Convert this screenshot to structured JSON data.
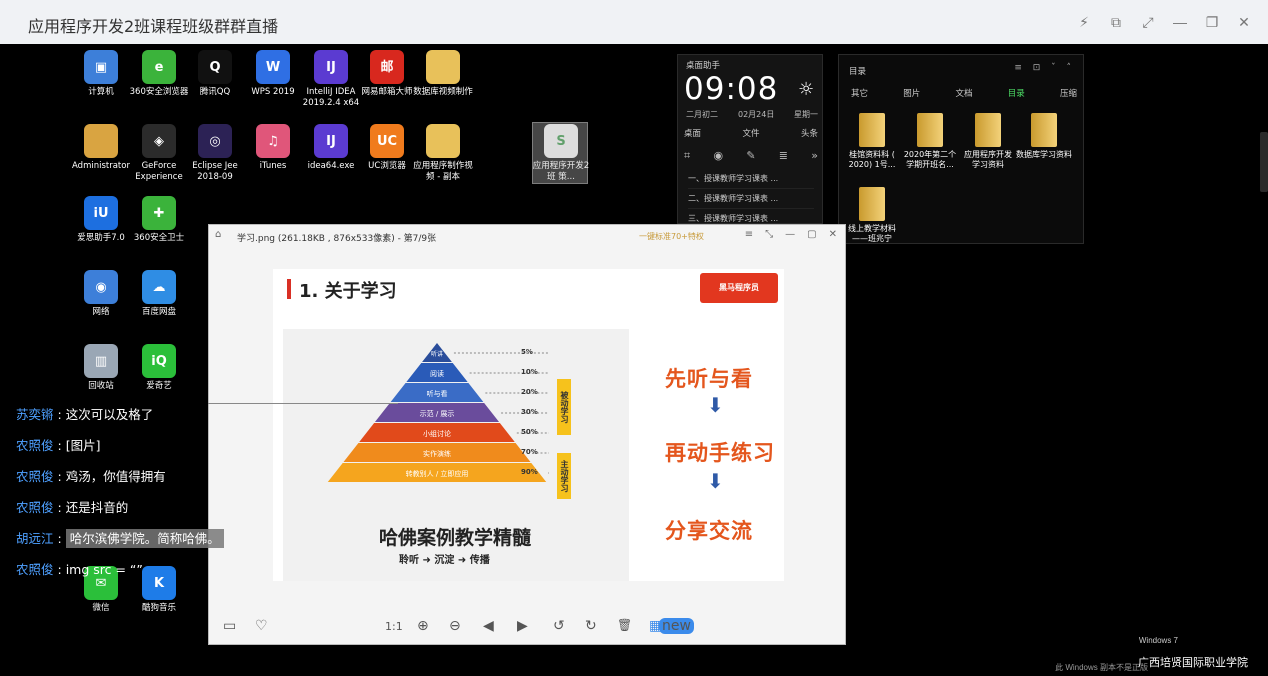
{
  "window": {
    "title": "应用程序开发2班课程班级群群直播",
    "controls": {
      "flash": "⚡",
      "screen": "⧉",
      "expand": "⤢",
      "minimize": "—",
      "restore": "❐",
      "close": "✕"
    }
  },
  "desktop_icons": [
    {
      "label": "计算机",
      "icon": "computer-icon",
      "color": "#3d7fd9",
      "glyph": "▣"
    },
    {
      "label": "360安全浏览器",
      "icon": "360-browser-icon",
      "color": "#3bb33b",
      "glyph": "e"
    },
    {
      "label": "腾讯QQ",
      "icon": "qq-icon",
      "color": "#111111",
      "glyph": "Q"
    },
    {
      "label": "WPS 2019",
      "icon": "wps-icon",
      "color": "#2f6fe4",
      "glyph": "W"
    },
    {
      "label": "IntelliJ IDEA 2019.2.4 x64",
      "icon": "intellij-icon",
      "color": "#5b3bd1",
      "glyph": "IJ"
    },
    {
      "label": "网易邮箱大师",
      "icon": "netease-mail-icon",
      "color": "#d8281e",
      "glyph": "邮"
    },
    {
      "label": "数据库视频制作",
      "icon": "folder-icon",
      "color": "#e8c15a",
      "glyph": ""
    },
    {
      "label": "Administrator",
      "icon": "user-folder-icon",
      "color": "#d9a441",
      "glyph": ""
    },
    {
      "label": "GeForce Experience",
      "icon": "geforce-icon",
      "color": "#2b2b2b",
      "glyph": "◈"
    },
    {
      "label": "Eclipse Jee 2018-09",
      "icon": "eclipse-icon",
      "color": "#2c2255",
      "glyph": "◎"
    },
    {
      "label": "iTunes",
      "icon": "itunes-icon",
      "color": "#e0567a",
      "glyph": "♫"
    },
    {
      "label": "idea64.exe",
      "icon": "intellij-icon",
      "color": "#5b3bd1",
      "glyph": "IJ"
    },
    {
      "label": "UC浏览器",
      "icon": "uc-browser-icon",
      "color": "#f07b1d",
      "glyph": "UC"
    },
    {
      "label": "应用程序制作视频 - 副本",
      "icon": "folder-icon",
      "color": "#e8c15a",
      "glyph": ""
    },
    {
      "label": "爱思助手7.0",
      "icon": "i4-icon",
      "color": "#1d6fe0",
      "glyph": "iU"
    },
    {
      "label": "360安全卫士",
      "icon": "360-guard-icon",
      "color": "#3bb33b",
      "glyph": "✚"
    },
    {
      "label": "网络",
      "icon": "network-icon",
      "color": "#3d7fd9",
      "glyph": "◉"
    },
    {
      "label": "百度网盘",
      "icon": "baidu-pan-icon",
      "color": "#2f8de4",
      "glyph": "☁"
    },
    {
      "label": "回收站",
      "icon": "recycle-bin-icon",
      "color": "#9aa7b5",
      "glyph": "▥"
    },
    {
      "label": "爱奇艺",
      "icon": "iqiyi-icon",
      "color": "#2bbf3a",
      "glyph": "iQ"
    },
    {
      "label": "微信",
      "icon": "wechat-icon",
      "color": "#2bbf3a",
      "glyph": "✉"
    },
    {
      "label": "酷狗音乐",
      "icon": "kugou-icon",
      "color": "#1e7ce8",
      "glyph": "K"
    },
    {
      "label": "应用程序开发2班 策...",
      "icon": "spreadsheet-icon",
      "color": "#e9e9e9",
      "glyph": "S"
    }
  ],
  "desk_helper": {
    "title": "桌面助手",
    "time": "09:08",
    "lunar": "二月初二",
    "date": "02月24日",
    "weekday": "星期一",
    "tabs": [
      "桌面",
      "文件",
      "头条"
    ],
    "docs": [
      "一、授课教师学习课表 ...",
      "二、授课教师学习课表 ...",
      "三、授课教师学习课表 ..."
    ]
  },
  "folder_panel": {
    "title": "目录",
    "tabs": [
      "其它",
      "图片",
      "文档",
      "目录",
      "压缩"
    ],
    "active_tab": "目录",
    "folders": [
      "桂馆资料科 ( 2020) 1号...",
      "2020年第二个学期开班名...",
      "应用程序开发 学习资料",
      "数据库学习资料",
      "线上教学材料——班兆宁"
    ]
  },
  "viewer": {
    "title": "学习.png (261.18KB , 876x533像素) - 第7/9张",
    "promo": "一键标准70+特权",
    "controls": {
      "menu": "≡",
      "fit": "⤡",
      "min": "—",
      "max": "▢",
      "close": "✕"
    },
    "toolbar": {
      "folder": "▭",
      "heart": "♡",
      "one_to_one": "1:1",
      "zoom_in": "⊕",
      "zoom_out": "⊖",
      "prev": "◀",
      "next": "▶",
      "rotate_left": "↺",
      "rotate_right": "↻",
      "delete": "🗑",
      "more": "▦",
      "new_badge": "new"
    }
  },
  "slide": {
    "title": "1. 关于学习",
    "brand": "黑马程序员",
    "pyramid_levels": [
      {
        "label": "听讲",
        "pct": "5%"
      },
      {
        "label": "阅读",
        "pct": "10%"
      },
      {
        "label": "听与看",
        "pct": "20%"
      },
      {
        "label": "示范 / 展示",
        "pct": "30%"
      },
      {
        "label": "小组讨论",
        "pct": "50%"
      },
      {
        "label": "实作演练",
        "pct": "70%"
      },
      {
        "label": "转教别人 / 立即应用",
        "pct": "90%"
      }
    ],
    "passive_label": "被动学习",
    "active_label": "主动学习",
    "caption": "哈佛案例教学精髓",
    "flow": [
      "聆听",
      "沉淀",
      "传播"
    ],
    "right_steps": [
      "先听与看",
      "再动手练习",
      "分享交流"
    ]
  },
  "chat": [
    {
      "name": "苏奕锵",
      "text": "这次可以及格了"
    },
    {
      "name": "农照俊",
      "text": "[图片]"
    },
    {
      "name": "农照俊",
      "text": "鸡汤，你值得拥有"
    },
    {
      "name": "农照俊",
      "text": "还是抖音的"
    },
    {
      "name": "胡远江",
      "text": "哈尔滨佛学院。简称哈佛。"
    },
    {
      "name": "农照俊",
      "text": "img src = “”"
    }
  ],
  "os": {
    "win7": "Windows 7",
    "notice": "此 Windows 副本不是正版"
  },
  "watermark": "广西培贤国际职业学院"
}
